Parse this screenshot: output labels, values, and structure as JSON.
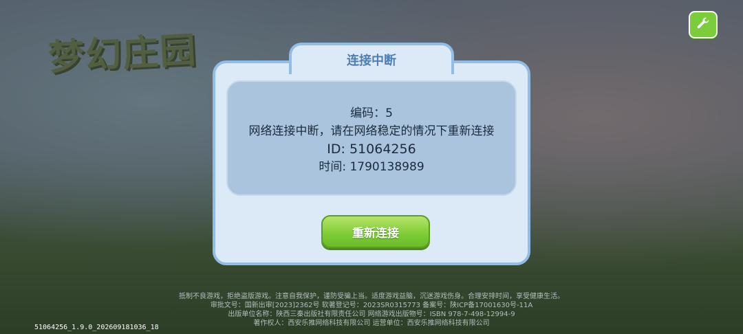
{
  "game": {
    "logo_text": "梦幻庄园"
  },
  "toolbar": {
    "settings_icon": "wrench-icon"
  },
  "dialog": {
    "title": "连接中断",
    "code_line": "编码：5",
    "message": "网络连接中断，请在网络稳定的情况下重新连接",
    "id_line": "ID: 51064256",
    "time_line": "时间: 1790138989",
    "reconnect_label": "重新连接"
  },
  "footer": {
    "legal_line1": "抵制不良游戏，拒绝盗版游戏。注意自我保护，谨防受骗上当。适度游戏益脑，沉迷游戏伤身。合理安排时间，享受健康生活。",
    "legal_line2": "审批文号：国新出审[2023]2362号    软著登记号：2023SR0315773    备案号：陕ICP备17001630号-11A",
    "legal_line3": "出版单位名称：陕西三秦出版社有限责任公司    网络游戏出版物号：ISBN 978-7-498-12994-9",
    "legal_line4": "著作权人：西安乐推网络科技有限公司  运营单位：西安乐推网络科技有限公司",
    "build_info": "51064256_1.9.0_202609181036_18"
  },
  "colors": {
    "accent_green": "#7ccd3b",
    "dialog_border": "#8fbde6",
    "title_blue": "#4f7fb2"
  }
}
